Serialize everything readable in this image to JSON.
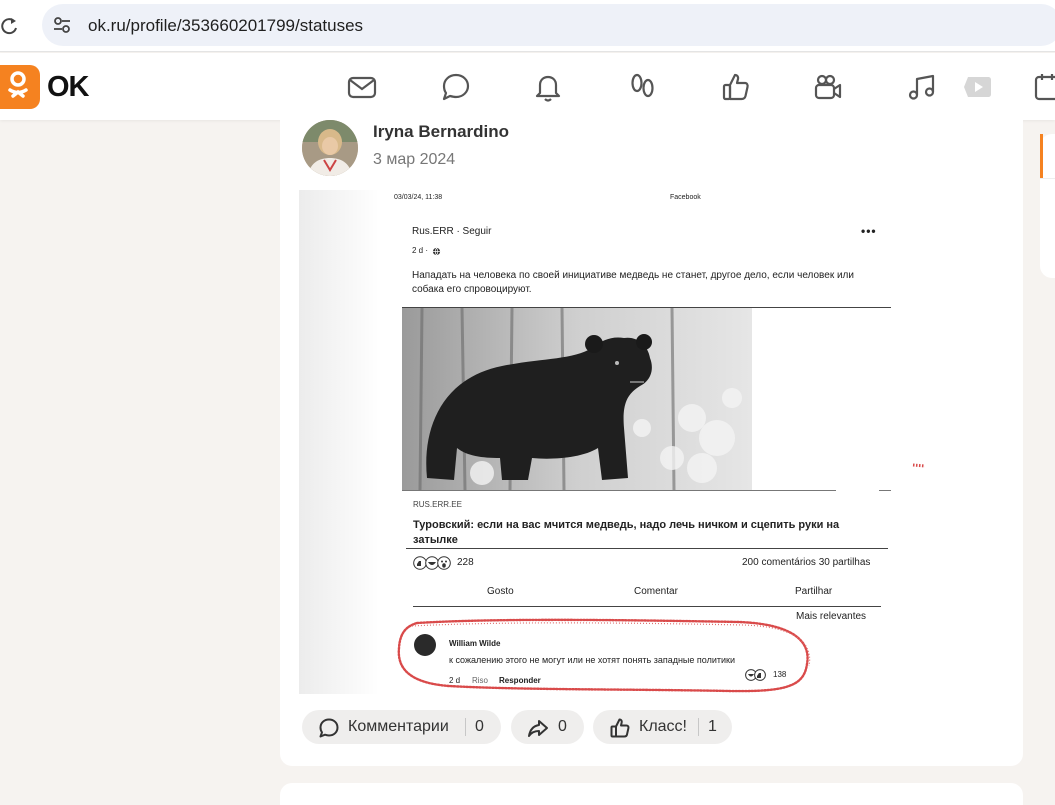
{
  "browser": {
    "url": "ok.ru/profile/353660201799/statuses"
  },
  "header": {
    "logo_text": "OK",
    "brand_color": "#f58220",
    "nav_icons": [
      "mail-icon",
      "chat-icon",
      "bell-icon",
      "guests-icon",
      "like-icon",
      "video-icon",
      "music-icon",
      "play-icon",
      "calendar-icon"
    ]
  },
  "post": {
    "author": "Iryna Bernardino",
    "date": "3 мар 2024",
    "scan": {
      "timestamp": "03/03/24, 11:38",
      "app_title": "Facebook",
      "source": "Rus.ERR · Seguir",
      "age": "2 d ·",
      "more": "•••",
      "text": "Нападать на человека по своей инициативе медведь не станет, другое дело, если человек или собака его спровоцируют.",
      "link_source": "RUS.ERR.EE",
      "link_title": "Туровский: если на вас мчится медведь, надо лечь ничком и сцепить руки на затылке",
      "reaction_count": "228",
      "comments_shares": "200 comentários   30 partilhas",
      "actions": [
        "Gosto",
        "Comentar",
        "Partilhar"
      ],
      "sort_label": "Mais relevantes",
      "comment": {
        "name": "William Wilde",
        "text": "к сожалению этого не могут или не хотят понять западные политики",
        "age": "2 d",
        "laugh": "Riso",
        "reply": "Responder",
        "likes": "138"
      }
    },
    "actions": {
      "comments_label": "Комментарии",
      "comments_count": "0",
      "shares_count": "0",
      "like_label": "Класс!",
      "like_count": "1"
    }
  }
}
